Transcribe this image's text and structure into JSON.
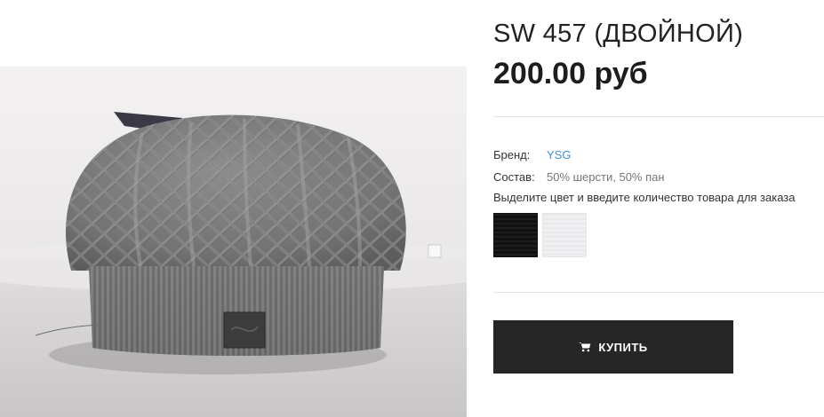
{
  "product": {
    "title": "SW 457 (ДВОЙНОЙ)",
    "price": "200.00 руб",
    "photo": {
      "icon": "knitted-beret-photo"
    }
  },
  "attributes": {
    "brand_label": "Бренд:",
    "brand_value": "YSG",
    "composition_label": "Состав:",
    "composition_value": "50% шерсти, 50% пан"
  },
  "colors": {
    "hint": "Выделите цвет и введите количество товара для заказа",
    "options": [
      {
        "name": "black",
        "hex": "#111111"
      },
      {
        "name": "white",
        "hex": "#f1eff2"
      }
    ]
  },
  "actions": {
    "buy_label": "КУПИТЬ",
    "buy_icon": "cart-icon",
    "link_color": "#3f8fd2",
    "button_color": "#262626"
  }
}
